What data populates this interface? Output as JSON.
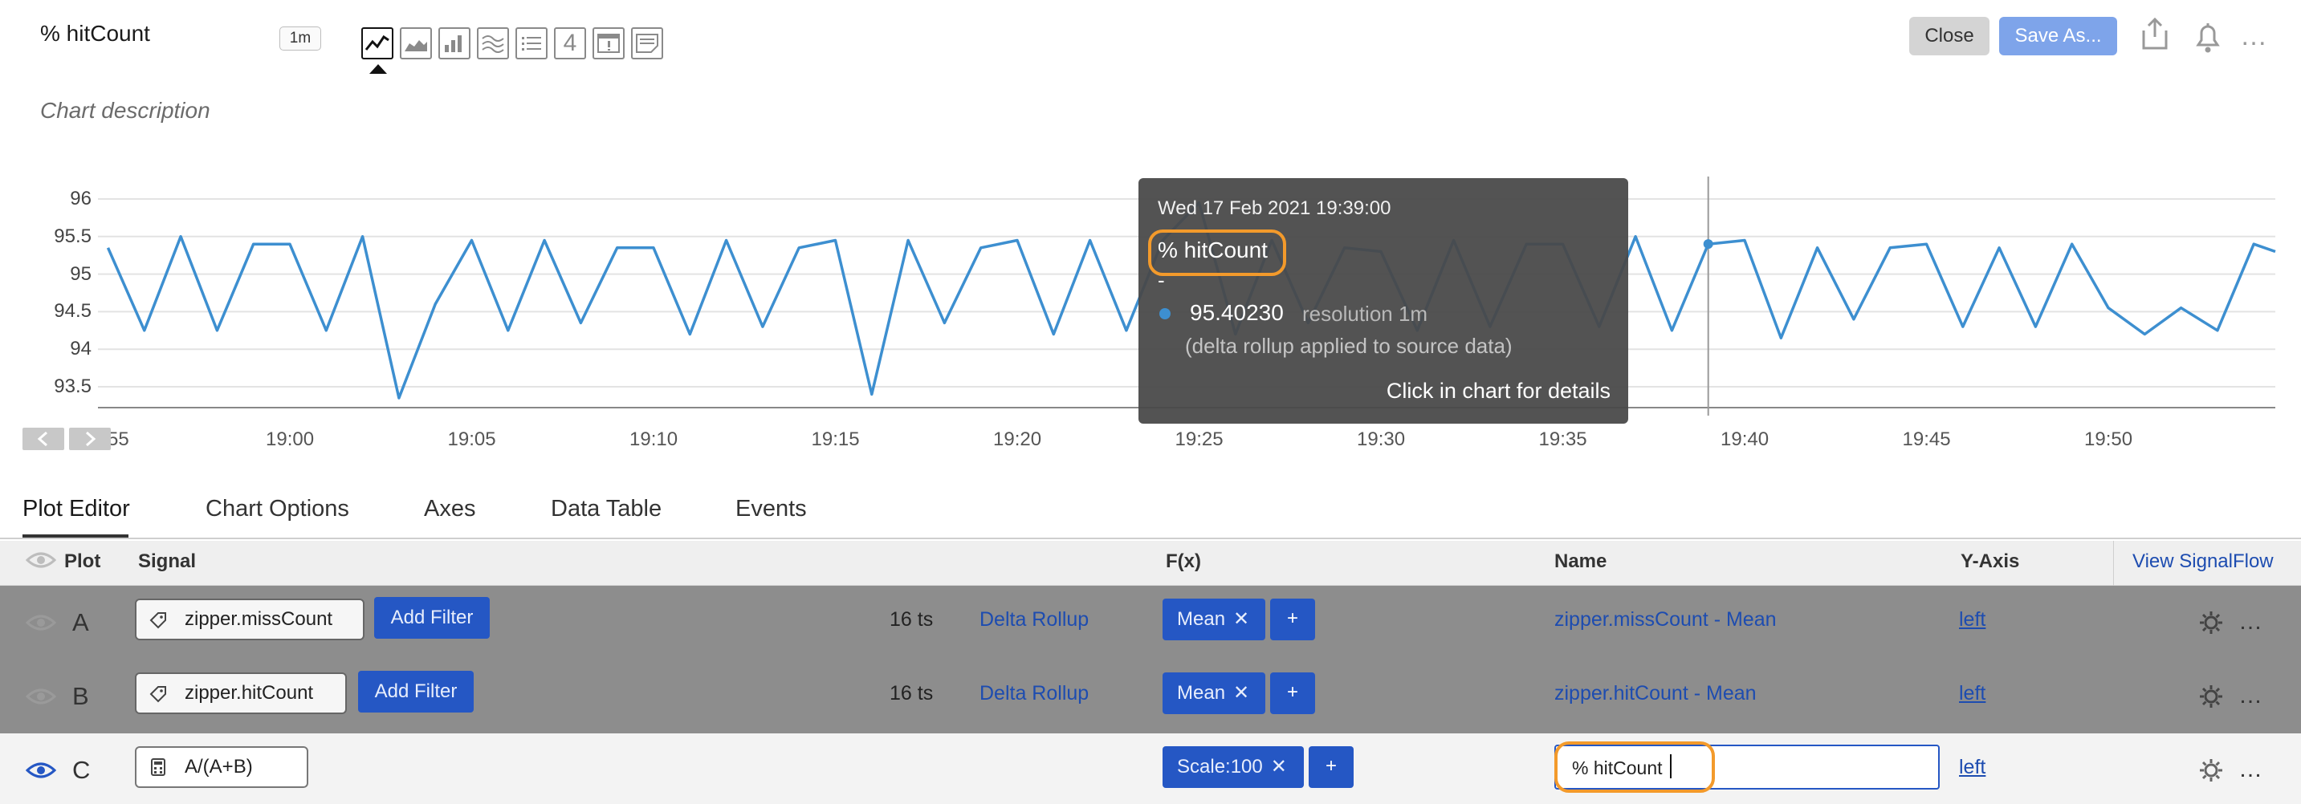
{
  "header": {
    "title": "% hitCount",
    "resolution_badge": "1m",
    "description_placeholder": "Chart description",
    "close_label": "Close",
    "save_as_label": "Save As...",
    "more_label": "…"
  },
  "visualization_toolbar": {
    "buttons": [
      "line-chart-icon",
      "area-chart-icon",
      "column-chart-icon",
      "histogram-icon",
      "list-icon",
      "single-value-icon",
      "heatmap-icon",
      "text-note-icon"
    ],
    "single_value_glyph": "4",
    "active": "line-chart-icon"
  },
  "chart_data": {
    "type": "line",
    "title": "",
    "xlabel": "",
    "ylabel": "",
    "ylim": [
      93.0,
      96.2
    ],
    "y_ticks": [
      "96",
      "95.5",
      "95",
      "94.5",
      "94",
      "93.5"
    ],
    "x_ticks": [
      "55",
      "19:00",
      "19:05",
      "19:10",
      "19:15",
      "19:20",
      "19:25",
      "19:30",
      "19:35",
      "19:40",
      "19:45",
      "19:50"
    ],
    "color": "#3d8fd0",
    "series": [
      {
        "x": [
          "18:55",
          "18:56",
          "18:57",
          "18:58",
          "18:59",
          "19:00",
          "19:01",
          "19:02",
          "19:03",
          "19:04",
          "19:05",
          "19:06",
          "19:07",
          "19:08",
          "19:09",
          "19:10",
          "19:11",
          "19:12",
          "19:13",
          "19:14",
          "19:15",
          "19:16",
          "19:17",
          "19:18",
          "19:19",
          "19:20",
          "19:21",
          "19:22",
          "19:23",
          "19:24",
          "19:25",
          "19:26",
          "19:27",
          "19:28",
          "19:29",
          "19:30",
          "19:31",
          "19:32",
          "19:33",
          "19:34",
          "19:35",
          "19:36",
          "19:37",
          "19:38",
          "19:39",
          "19:40",
          "19:41",
          "19:42",
          "19:43",
          "19:44",
          "19:45",
          "19:46",
          "19:47",
          "19:48",
          "19:49",
          "19:50",
          "19:51",
          "19:52",
          "19:53",
          "19:54",
          "19:55"
        ],
        "values": [
          95.35,
          94.25,
          95.5,
          94.25,
          95.4,
          95.4,
          94.25,
          95.5,
          93.35,
          94.6,
          95.45,
          94.25,
          95.45,
          94.35,
          95.35,
          95.35,
          94.2,
          95.45,
          94.3,
          95.35,
          95.45,
          93.4,
          95.45,
          94.35,
          95.35,
          95.45,
          94.2,
          95.45,
          94.25,
          95.45,
          95.95,
          94.2,
          95.45,
          94.35,
          95.35,
          95.3,
          94.25,
          95.45,
          94.3,
          95.4,
          95.4,
          94.3,
          95.5,
          94.25,
          95.4,
          95.45,
          94.15,
          95.35,
          94.4,
          95.35,
          95.4,
          94.3,
          95.35,
          94.3,
          95.4,
          94.55,
          94.2,
          94.55,
          94.25,
          95.4,
          95.3
        ]
      }
    ],
    "grid": true
  },
  "tooltip": {
    "timestamp": "Wed 17 Feb 2021 19:39:00",
    "series_name": "% hitCount",
    "dash": "-",
    "value": "95.40230",
    "resolution": "resolution 1m",
    "rollup_note": "(delta rollup applied to source data)",
    "footer": "Click in chart for details"
  },
  "tabs": [
    "Plot Editor",
    "Chart Options",
    "Axes",
    "Data Table",
    "Events"
  ],
  "table": {
    "headers": {
      "plot": "Plot",
      "signal": "Signal",
      "fx": "F(x)",
      "name": "Name",
      "yaxis": "Y-Axis",
      "view_signalflow": "View SignalFlow"
    },
    "rows": [
      {
        "letter": "A",
        "signal": "zipper.missCount",
        "add_filter": "Add Filter",
        "ts": "16 ts",
        "rollup": "Delta Rollup",
        "fx": "Mean",
        "plus": "+",
        "name": "zipper.missCount - Mean",
        "yaxis": "left"
      },
      {
        "letter": "B",
        "signal": "zipper.hitCount",
        "add_filter": "Add Filter",
        "ts": "16 ts",
        "rollup": "Delta Rollup",
        "fx": "Mean",
        "plus": "+",
        "name": "zipper.hitCount - Mean",
        "yaxis": "left"
      },
      {
        "letter": "C",
        "signal": "A/(A+B)",
        "fx": "Scale:100",
        "plus": "+",
        "name": "% hitCount",
        "yaxis": "left"
      }
    ]
  },
  "colors": {
    "accent": "#2557c4",
    "line": "#3d8fd0",
    "highlight": "#f39a2b"
  }
}
